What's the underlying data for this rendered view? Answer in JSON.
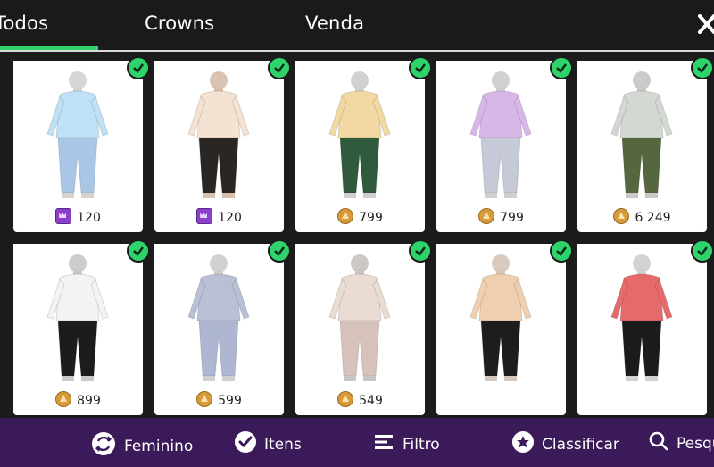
{
  "tabs": [
    {
      "label": "Todos",
      "active": true
    },
    {
      "label": "Crowns",
      "active": false
    },
    {
      "label": "Venda",
      "active": false
    }
  ],
  "close_icon": "close-icon",
  "accent_color": "#2fd36b",
  "bottom_color": "#3a1a58",
  "items": [
    {
      "price": "120",
      "currency": "crown",
      "owned": true,
      "outfit": {
        "top": "#bfe1f7",
        "bottom": "#a9c6e6",
        "skin": "#d7d3d0"
      }
    },
    {
      "price": "120",
      "currency": "crown",
      "owned": true,
      "outfit": {
        "top": "#f4e2d2",
        "bottom": "#2a2624",
        "skin": "#d9c0ad"
      }
    },
    {
      "price": "799",
      "currency": "gold",
      "owned": true,
      "outfit": {
        "top": "#f2d9a3",
        "bottom": "#2f5a3c",
        "skin": "#cfcfcf"
      }
    },
    {
      "price": "799",
      "currency": "gold",
      "owned": true,
      "outfit": {
        "top": "#d7b7e8",
        "bottom": "#c6c9d8",
        "skin": "#d0cfcf"
      }
    },
    {
      "price": "6 249",
      "currency": "gold",
      "owned": true,
      "outfit": {
        "top": "#d4d8d2",
        "bottom": "#56663e",
        "skin": "#c8c9c7"
      }
    },
    {
      "price": "899",
      "currency": "gold",
      "owned": true,
      "outfit": {
        "top": "#f3f3f3",
        "bottom": "#1c1c1c",
        "skin": "#c9c9c9"
      }
    },
    {
      "price": "599",
      "currency": "gold",
      "owned": true,
      "outfit": {
        "top": "#b9c0d6",
        "bottom": "#aeb6d1",
        "skin": "#cfcfcf"
      }
    },
    {
      "price": "549",
      "currency": "gold",
      "owned": true,
      "outfit": {
        "top": "#eadbd3",
        "bottom": "#d7c2bb",
        "skin": "#c9c6c2"
      }
    },
    {
      "price": "",
      "currency": "",
      "owned": true,
      "outfit": {
        "top": "#f0cfb1",
        "bottom": "#1d1d1d",
        "skin": "#d6c7bc"
      }
    },
    {
      "price": "",
      "currency": "",
      "owned": true,
      "outfit": {
        "top": "#e56b6b",
        "bottom": "#1b1b1b",
        "skin": "#d1d1d1"
      }
    }
  ],
  "bottom_nav": [
    {
      "label": "Feminino",
      "icon": "gender-swap-icon"
    },
    {
      "label": "Itens",
      "icon": "check-circle-icon"
    },
    {
      "label": "Filtro",
      "icon": "filter-icon"
    },
    {
      "label": "Classificar",
      "icon": "star-badge-icon"
    },
    {
      "label": "Pesqui",
      "icon": "search-icon"
    }
  ]
}
